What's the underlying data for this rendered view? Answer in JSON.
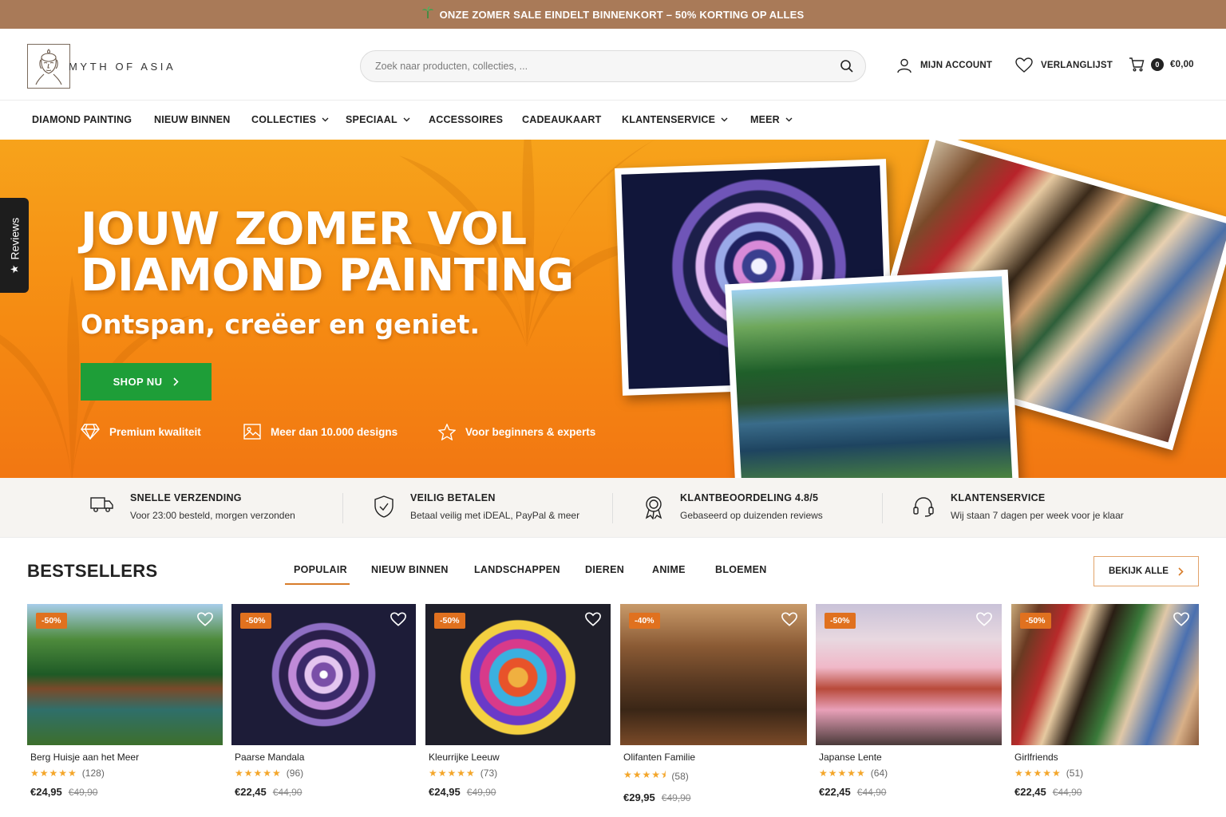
{
  "announcement": {
    "text": "ONZE ZOMER SALE EINDELT BINNENKORT – 50% KORTING OP ALLES",
    "icon": "palm-tree-icon"
  },
  "header": {
    "logo_text": "MYTH OF ASIA",
    "search_placeholder": "Zoek naar producten, collecties, ...",
    "account_label": "MIJN ACCOUNT",
    "wishlist_label": "VERLANGLIJST",
    "cart_count": "0",
    "cart_total": "€0,00"
  },
  "nav": {
    "items": [
      {
        "label": "DIAMOND PAINTING",
        "has_dropdown": false
      },
      {
        "label": "NIEUW BINNEN",
        "has_dropdown": false
      },
      {
        "label": "COLLECTIES",
        "has_dropdown": true
      },
      {
        "label": "SPECIAAL",
        "has_dropdown": true
      },
      {
        "label": "ACCESSOIRES",
        "has_dropdown": false
      },
      {
        "label": "CADEAUKAART",
        "has_dropdown": false
      },
      {
        "label": "KLANTENSERVICE",
        "has_dropdown": true
      },
      {
        "label": "MEER",
        "has_dropdown": true
      }
    ]
  },
  "hero": {
    "title_line1": "JOUW ZOMER VOL",
    "title_line2": "DIAMOND PAINTING",
    "subtitle": "Ontspan, creëer en geniet.",
    "cta_label": "SHOP NU",
    "usps": [
      {
        "label": "Premium kwaliteit",
        "icon": "diamond-icon"
      },
      {
        "label": "Meer dan 10.000 designs",
        "icon": "image-icon"
      },
      {
        "label": "Voor beginners & experts",
        "icon": "star-icon"
      }
    ],
    "colors": {
      "gradient_top": "#f7a31b",
      "gradient_bottom": "#f27712",
      "cta": "#1e9e38"
    }
  },
  "reviews_tab": {
    "label": "Reviews",
    "icon": "star-icon"
  },
  "trust": [
    {
      "title": "SNELLE VERZENDING",
      "desc": "Voor 23:00 besteld, morgen verzonden",
      "icon": "truck-icon"
    },
    {
      "title": "VEILIG BETALEN",
      "desc": "Betaal veilig met iDEAL, PayPal & meer",
      "icon": "shield-check-icon"
    },
    {
      "title": "KLANTBEOORDELING 4.8/5",
      "desc": "Gebaseerd op duizenden reviews",
      "icon": "award-icon"
    },
    {
      "title": "KLANTENSERVICE",
      "desc": "Wij staan 7 dagen per week voor je klaar",
      "icon": "headset-icon"
    }
  ],
  "bestsellers": {
    "title": "BESTSELLERS",
    "tabs": [
      "POPULAIR",
      "NIEUW BINNEN",
      "LANDSCHAPPEN",
      "DIEREN",
      "ANIME",
      "BLOEMEN"
    ],
    "active_tab": "POPULAIR",
    "view_all_label": "BEKIJK ALLE",
    "products": [
      {
        "name": "Berg Huisje aan het Meer",
        "badge": "-50%",
        "rating": 5,
        "reviews": "(128)",
        "price": "€24,95",
        "old_price": "€49,90"
      },
      {
        "name": "Paarse Mandala",
        "badge": "-50%",
        "rating": 5,
        "reviews": "(96)",
        "price": "€22,45",
        "old_price": "€44,90"
      },
      {
        "name": "Kleurrijke Leeuw",
        "badge": "-50%",
        "rating": 5,
        "reviews": "(73)",
        "price": "€24,95",
        "old_price": "€49,90"
      },
      {
        "name": "Olifanten Familie",
        "badge": "-40%",
        "rating": 4.5,
        "reviews": "(58)",
        "price": "€29,95",
        "old_price": "€49,90"
      },
      {
        "name": "Japanse Lente",
        "badge": "-50%",
        "rating": 5,
        "reviews": "(64)",
        "price": "€22,45",
        "old_price": "€44,90"
      },
      {
        "name": "Girlfriends",
        "badge": "-50%",
        "rating": 5,
        "reviews": "(51)",
        "price": "€22,45",
        "old_price": "€44,90"
      }
    ]
  },
  "colors": {
    "announcement_bg": "#a97a58",
    "accent": "#e0711f",
    "star": "#f4a62a"
  }
}
